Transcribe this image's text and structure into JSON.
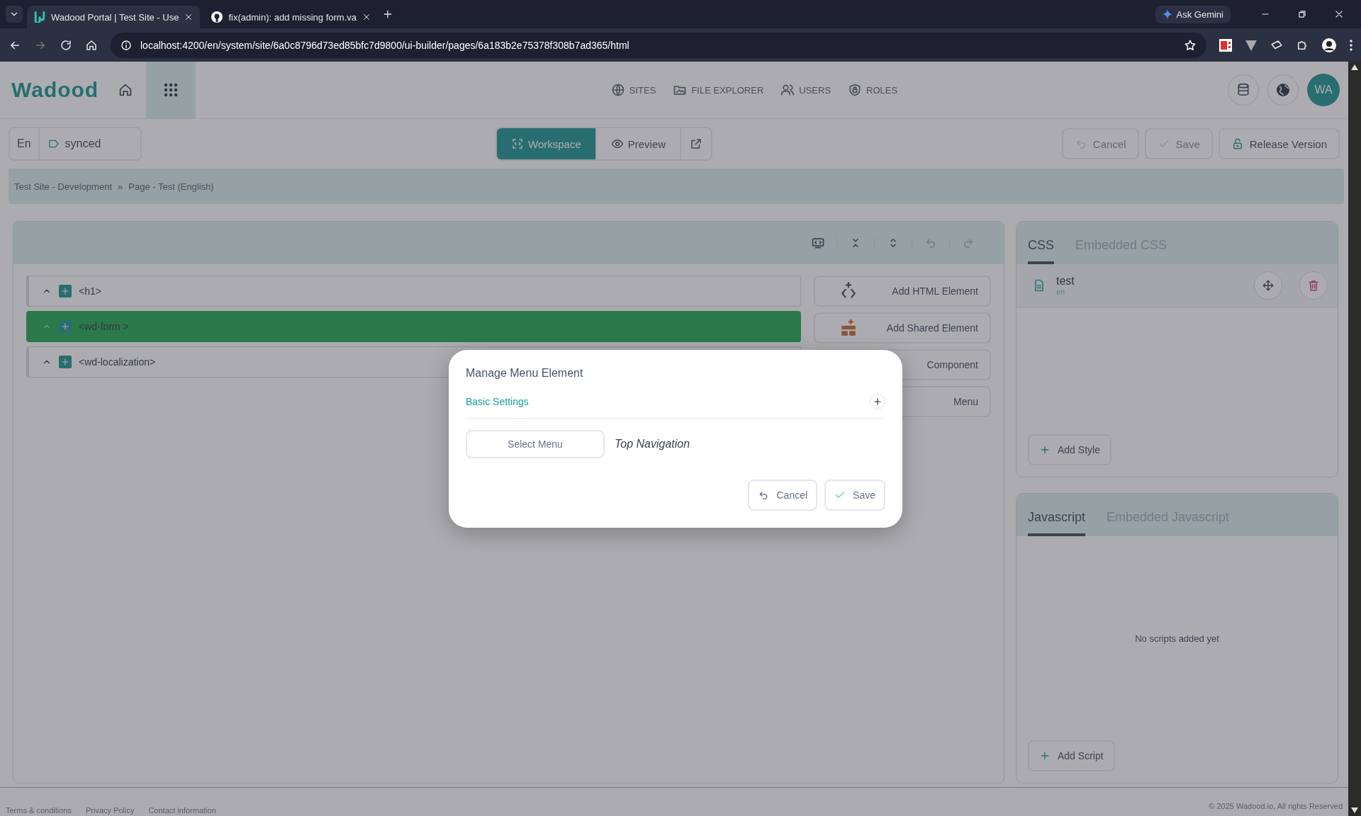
{
  "browser": {
    "tabs": [
      {
        "title": "Wadood Portal | Test Site - Use",
        "selected": true
      },
      {
        "title": "fix(admin): add missing form.va",
        "selected": false
      }
    ],
    "url": "localhost:4200/en/system/site/6a0c8796d73ed85bfc7d9800/ui-builder/pages/6a183b2e75378f308b7ad365/html",
    "gemini": "Ask Gemini"
  },
  "header": {
    "logo": "Wadood",
    "nav": [
      {
        "label": "SITES"
      },
      {
        "label": "FILE EXPLORER"
      },
      {
        "label": "USERS"
      },
      {
        "label": "ROLES"
      }
    ],
    "avatar": "WA"
  },
  "toolbar": {
    "language": "En",
    "status": "synced",
    "views": [
      {
        "label": "Workspace",
        "selected": true
      },
      {
        "label": "Preview",
        "selected": false
      }
    ],
    "actions": [
      {
        "label": "Cancel",
        "disabled": true
      },
      {
        "label": "Save",
        "disabled": true
      },
      {
        "label": "Release Version",
        "disabled": false
      }
    ]
  },
  "breadcrumb": {
    "items": [
      "Test Site - Development",
      "Page - Test (English)"
    ],
    "separator": "»"
  },
  "tree": {
    "rows": [
      {
        "tag": "<h1>",
        "selected": false
      },
      {
        "tag": "<wd-form >",
        "selected": true
      },
      {
        "tag": "<wd-localization>",
        "selected": false
      }
    ]
  },
  "add_buttons": [
    "Add HTML Element",
    "Add Shared Element",
    "Component",
    "Menu"
  ],
  "css_panel": {
    "tabs": [
      {
        "label": "CSS",
        "selected": true
      },
      {
        "label": "Embedded CSS",
        "selected": false
      }
    ],
    "files": [
      {
        "name": "test",
        "lang": "en"
      }
    ],
    "add": "Add Style"
  },
  "js_panel": {
    "tabs": [
      {
        "label": "Javascript",
        "selected": true
      },
      {
        "label": "Embedded Javascript",
        "selected": false
      }
    ],
    "empty": "No scripts added yet",
    "add": "Add Script"
  },
  "modal": {
    "title": "Manage Menu Element",
    "section": "Basic Settings",
    "select": "Select Menu",
    "value": "Top Navigation",
    "buttons": [
      "Cancel",
      "Save"
    ]
  },
  "footer": {
    "links": [
      "Terms & conditions",
      "Privacy Policy",
      "Contact information"
    ],
    "copyright": "© 2025 Wadood.io, All rights Reserved"
  }
}
